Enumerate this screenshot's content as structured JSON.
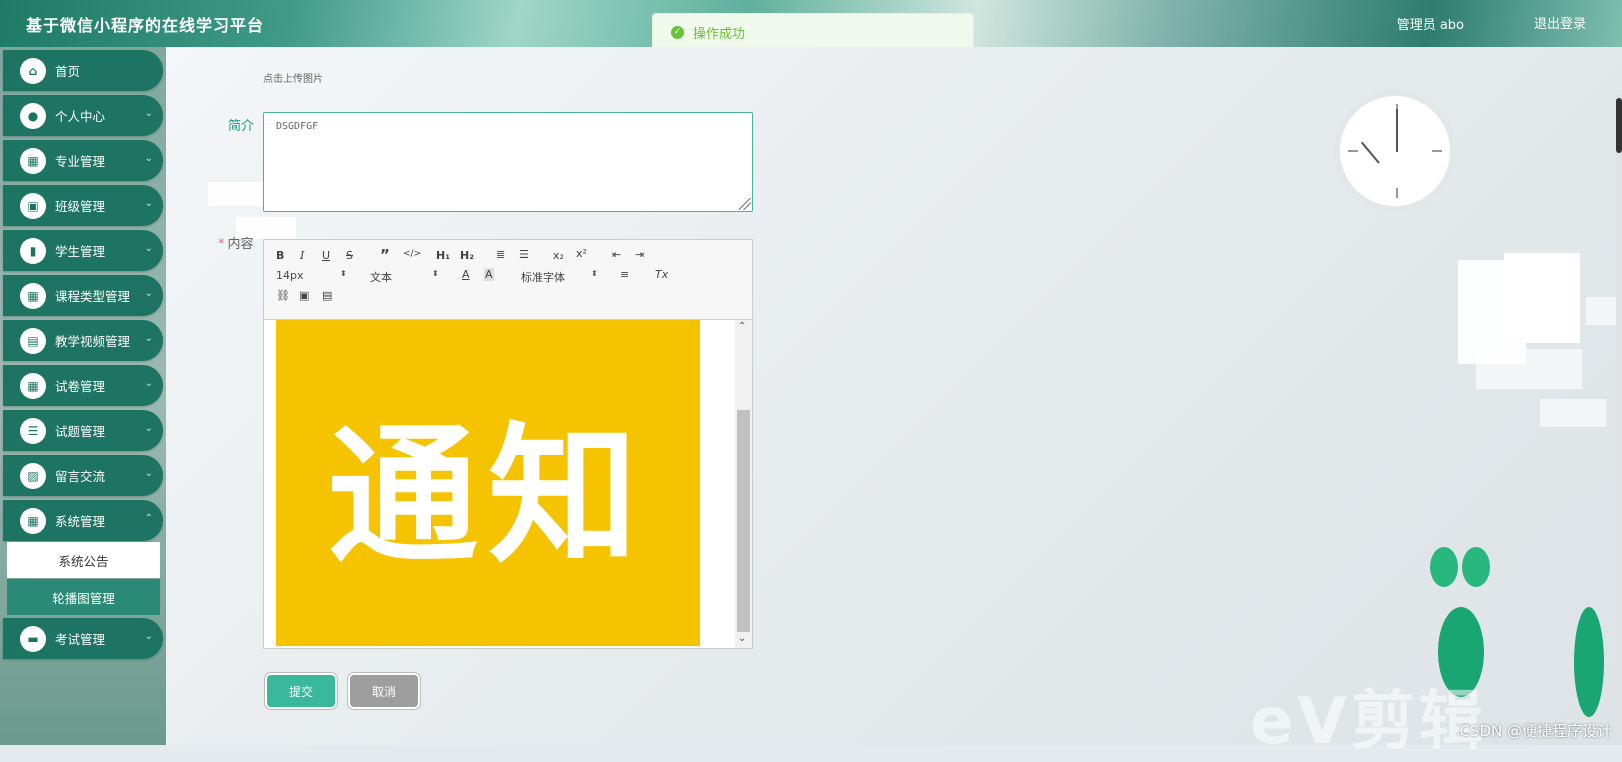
{
  "header": {
    "title": "基于微信小程序的在线学习平台",
    "admin": "管理员 abo",
    "logout": "退出登录"
  },
  "toast": {
    "message": "操作成功"
  },
  "sidebar": {
    "items": [
      {
        "label": "首页",
        "icon": "home-icon"
      },
      {
        "label": "个人中心",
        "icon": "user-icon"
      },
      {
        "label": "专业管理",
        "icon": "grid-icon"
      },
      {
        "label": "班级管理",
        "icon": "briefcase-icon"
      },
      {
        "label": "学生管理",
        "icon": "chart-icon"
      },
      {
        "label": "课程类型管理",
        "icon": "grid-icon"
      },
      {
        "label": "教学视频管理",
        "icon": "clipboard-icon"
      },
      {
        "label": "试卷管理",
        "icon": "grid-icon"
      },
      {
        "label": "试题管理",
        "icon": "list-icon"
      },
      {
        "label": "留言交流",
        "icon": "message-icon"
      },
      {
        "label": "系统管理",
        "icon": "grid-icon"
      },
      {
        "label": "考试管理",
        "icon": "monitor-icon"
      }
    ],
    "submenu": [
      {
        "label": "系统公告"
      },
      {
        "label": "轮播图管理"
      }
    ]
  },
  "form": {
    "upload_hint": "点击上传图片",
    "intro_label": "简介",
    "intro_value": "DSGDFGF",
    "content_label": "内容",
    "required_mark": "*",
    "toolbar": {
      "font_size": "14px",
      "block_format": "文本",
      "font_family": "标准字体"
    },
    "notice_text": "通知",
    "submit": "提交",
    "cancel": "取消"
  },
  "watermark": {
    "ev": "eV剪辑",
    "csdn": "CSDN @便捷程序设计"
  },
  "colors": {
    "primary": "#1d7463",
    "accent": "#3ab89c",
    "notice_bg": "#f5c300",
    "success": "#67c23a"
  }
}
